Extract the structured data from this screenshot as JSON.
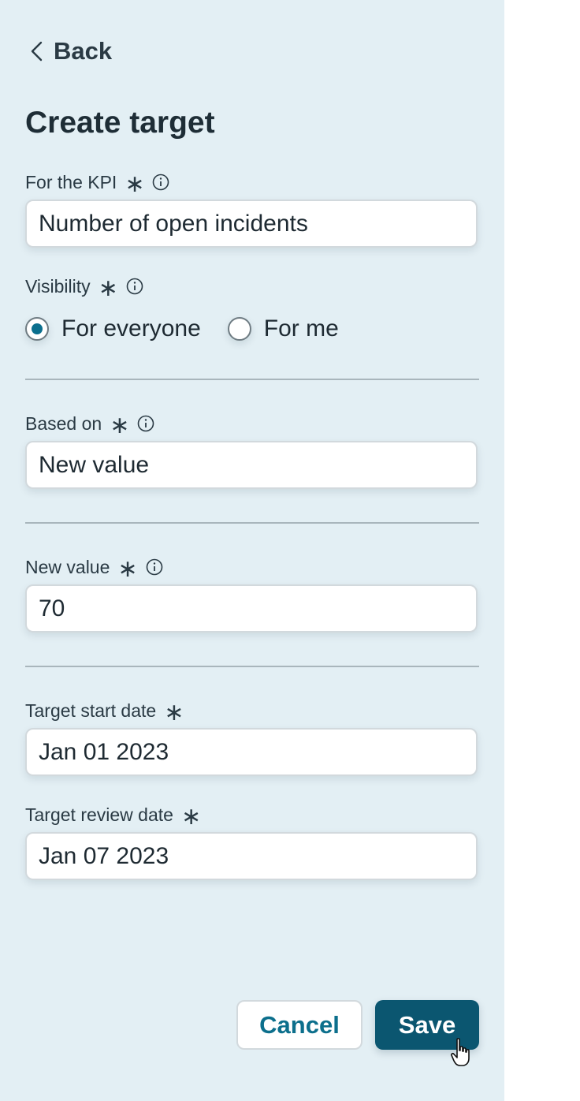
{
  "header": {
    "back_label": "Back",
    "title": "Create target"
  },
  "form": {
    "kpi": {
      "label": "For the KPI",
      "value": "Number of open incidents"
    },
    "visibility": {
      "label": "Visibility",
      "options": [
        {
          "label": "For everyone",
          "selected": true
        },
        {
          "label": "For me",
          "selected": false
        }
      ]
    },
    "based_on": {
      "label": "Based on",
      "value": "New value"
    },
    "new_value": {
      "label": "New value",
      "value": "70"
    },
    "start_date": {
      "label": "Target start date",
      "value": "Jan 01 2023"
    },
    "review_date": {
      "label": "Target review date",
      "value": "Jan 07 2023"
    }
  },
  "required_mark": "∗",
  "actions": {
    "cancel_label": "Cancel",
    "save_label": "Save"
  },
  "colors": {
    "panel": "#e3eff4",
    "accent": "#0b5670",
    "link": "#0c6f8c"
  }
}
